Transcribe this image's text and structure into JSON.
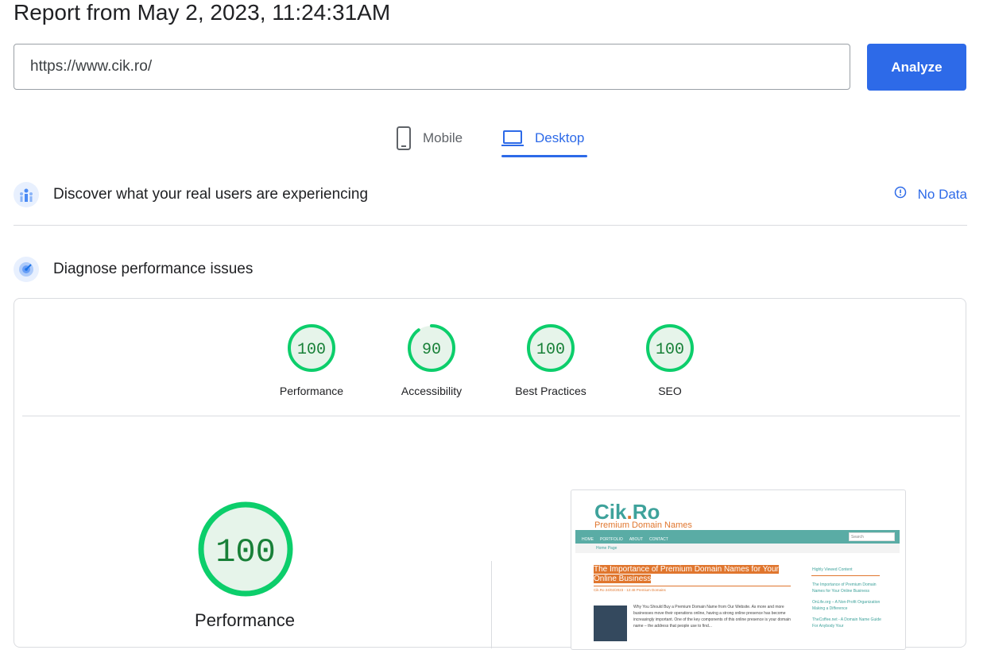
{
  "report_title": "Report from May 2, 2023, 11:24:31AM",
  "url_input": {
    "value": "https://www.cik.ro/"
  },
  "analyze_label": "Analyze",
  "tabs": [
    {
      "label": "Mobile",
      "active": false
    },
    {
      "label": "Desktop",
      "active": true
    }
  ],
  "field_data": {
    "title": "Discover what your real users are experiencing",
    "status": "No Data"
  },
  "lab_data": {
    "title": "Diagnose performance issues"
  },
  "scores": [
    {
      "label": "Performance",
      "value": "100",
      "fraction": 1.0
    },
    {
      "label": "Accessibility",
      "value": "90",
      "fraction": 0.9
    },
    {
      "label": "Best Practices",
      "value": "100",
      "fraction": 1.0
    },
    {
      "label": "SEO",
      "value": "100",
      "fraction": 1.0
    }
  ],
  "main_score": {
    "label": "Performance",
    "value": "100",
    "fraction": 1.0
  },
  "colors": {
    "accent": "#2d6ae8",
    "pass": "#0cce6b",
    "pass_bg": "#e6f4ea",
    "pass_text": "#188038"
  },
  "preview": {
    "logo_main": "Cik",
    "logo_dot": ".",
    "logo_end": "Ro",
    "tagline": "Premium Domain Names",
    "nav": [
      "HOME",
      "PORTFOLIO",
      "ABOUT",
      "CONTACT"
    ],
    "search_placeholder": "Search",
    "breadcrumb": "Home Page",
    "headline": "The Importance of Premium Domain Names for Your Online Business",
    "meta": "Cik.Ro   24/02/2023 - 12:48   Premium Domains",
    "body": "Why You Should Buy a Premium Domain Name from Our Website. As more and more businesses move their operations online, having a strong online presence has become increasingly important. One of the key components of this online presence is your domain name – the address that people use to find...",
    "sidebar_title": "Highly Viewed Content",
    "sidebar_items": [
      "The Importance of Premium Domain Names for Your Online Business",
      "OnLife.org – A Non-Profit Organization Making a Difference",
      "TheCoffee.net - A Domain Name Guide For Anybody Your"
    ]
  }
}
